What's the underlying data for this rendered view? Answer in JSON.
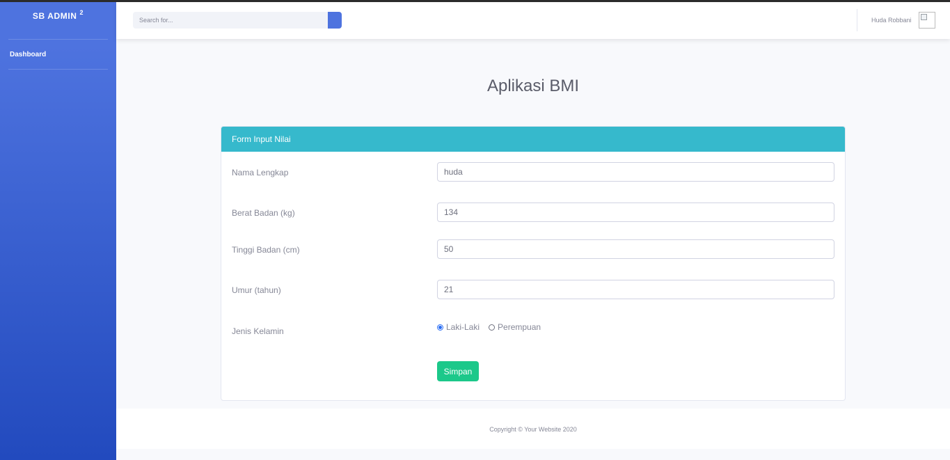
{
  "sidebar": {
    "brand": "SB ADMIN",
    "brand_sup": "2",
    "nav": [
      {
        "label": "Dashboard"
      }
    ]
  },
  "topbar": {
    "search_placeholder": "Search for...",
    "user_name": "Huda Robbani",
    "icons": [
      "search-icon",
      "avatar-broken-image-icon"
    ]
  },
  "page": {
    "title": "Aplikasi BMI"
  },
  "form": {
    "header": "Form Input Nilai",
    "fields": [
      {
        "label": "Nama Lengkap",
        "value": "huda"
      },
      {
        "label": "Berat Badan (kg)",
        "value": "134"
      },
      {
        "label": "Tinggi Badan (cm)",
        "value": "50"
      },
      {
        "label": "Umur (tahun)",
        "value": "21"
      }
    ],
    "gender": {
      "label": "Jenis Kelamin",
      "options": [
        "Laki-Laki",
        "Perempuan"
      ],
      "selected": "Laki-Laki"
    },
    "submit_label": "Simpan"
  },
  "footer": {
    "text": "Copyright © Your Website 2020"
  },
  "colors": {
    "sidebar_gradient_start": "#4e73df",
    "sidebar_gradient_end": "#224abe",
    "card_header": "#36b9cc",
    "submit_button": "#1cc88a",
    "search_button": "#4e73df"
  }
}
